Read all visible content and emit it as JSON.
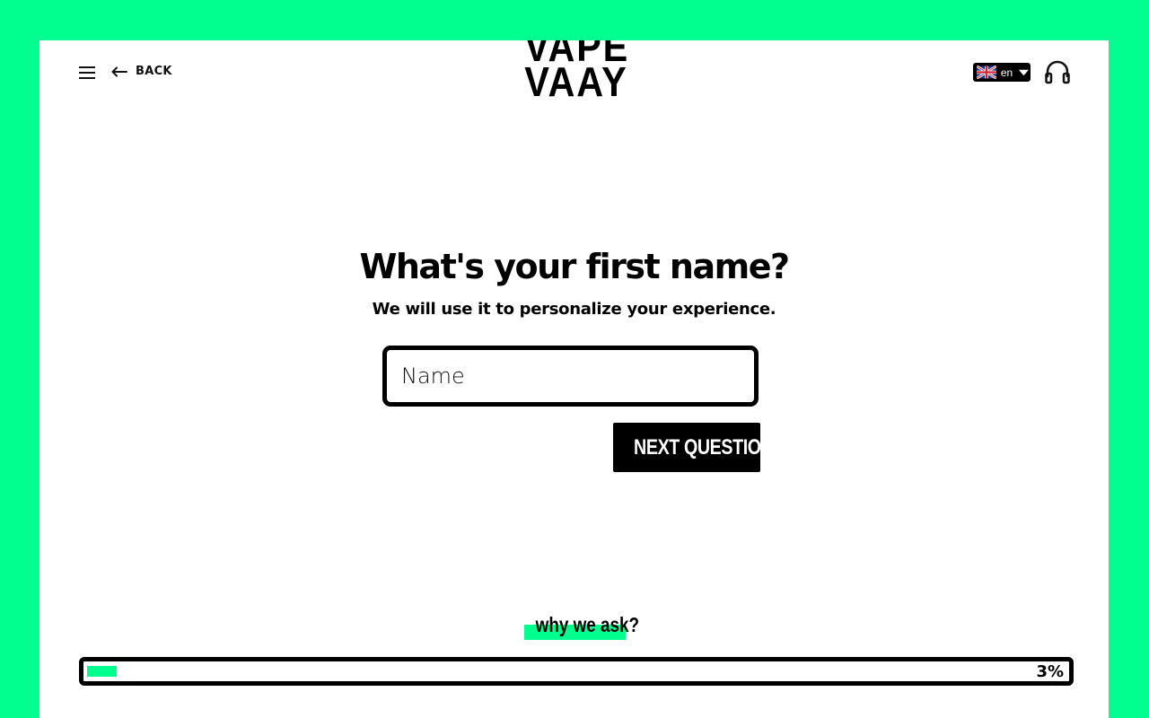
{
  "header": {
    "back_label": "BACK",
    "logo_lines": [
      "VAPE",
      "VAAY"
    ],
    "language": {
      "code": "en",
      "flag": "uk-flag-icon"
    }
  },
  "question": {
    "title": "What's your first name?",
    "subtitle": "We will use it to personalize your experience.",
    "input_placeholder": "Name",
    "input_value": "",
    "next_label": "NEXT QUESTION",
    "why_label": "why we ask?"
  },
  "progress": {
    "percent": 3,
    "label": "3%"
  },
  "colors": {
    "accent": "#00ff8f",
    "text": "#000000",
    "panel": "#ffffff"
  }
}
